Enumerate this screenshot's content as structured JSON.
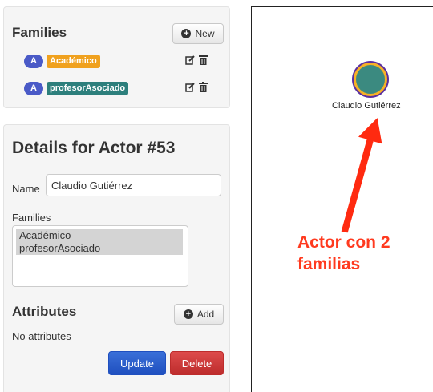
{
  "families_panel": {
    "title": "Families",
    "new_label": "New",
    "items": [
      {
        "badge": "A",
        "label": "Académico",
        "color": "#f0a11e"
      },
      {
        "badge": "A",
        "label": "profesorAsociado",
        "color": "#2d7f7c"
      }
    ]
  },
  "details_panel": {
    "title": "Details for Actor #53",
    "name_label": "Name",
    "name_value": "Claudio Gutiérrez",
    "families_label": "Families",
    "families_options": [
      "Académico",
      "profesorAsociado"
    ],
    "attributes_title": "Attributes",
    "add_label": "Add",
    "no_attributes": "No attributes",
    "update_label": "Update",
    "delete_label": "Delete"
  },
  "graph": {
    "node_label": "Claudio Gutiérrez",
    "node_fill": "#3b8a80",
    "node_ring": "#f7b126",
    "node_outline": "#5a2fa0",
    "annotation_line1": "Actor con 2",
    "annotation_line2": "familias",
    "annotation_color": "#ff3a1f"
  },
  "icons": [
    "plus-circle-icon",
    "edit-icon",
    "trash-icon",
    "arrow-icon"
  ]
}
